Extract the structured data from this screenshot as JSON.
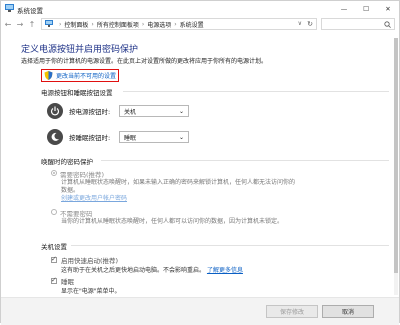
{
  "window": {
    "title": "系统设置",
    "controls": {
      "minimize": "—",
      "maximize": "☐",
      "close": "✕"
    }
  },
  "address_bar": {
    "back": "←",
    "forward": "→",
    "up": "↑",
    "crumbs": [
      "控制面板",
      "所有控制面板项",
      "电源选项",
      "系统设置"
    ],
    "dropdown": "∨",
    "refresh": "↻"
  },
  "main": {
    "heading": "定义电源按钮并启用密码保护",
    "description": "选择适用于你的计算机的电源设置。在此页上对设置所做的更改将应用于你所有的电源计划。",
    "change_link": "更改当前不可用的设置",
    "power_section": {
      "title": "电源按钮和睡眠按钮设置",
      "rows": [
        {
          "label": "按电源按钮时:",
          "value": "关机"
        },
        {
          "label": "按睡眠按钮时:",
          "value": "睡眠"
        }
      ]
    },
    "wake_section": {
      "title": "唤醒时的密码保护",
      "options": [
        {
          "label": "需要密码(推荐)",
          "desc_line1": "计算机从睡眠状态唤醒时，如果未输入正确的密码来解锁计算机，任何人都无法访问你的",
          "desc_line2": "数据。",
          "link": "创建或更改用户帐户密码",
          "checked": true
        },
        {
          "label": "不需要密码",
          "desc_line1": "当你的计算机从睡眠状态唤醒时，任何人都可以访问你的数据，因为计算机未锁定。",
          "checked": false
        }
      ]
    },
    "shutdown_section": {
      "title": "关机设置",
      "options": [
        {
          "label": "启用快速启动(推荐)",
          "desc": "这有助于在关机之后更快地启动电脑。不会影响重启。",
          "link": "了解更多信息",
          "checked": true
        },
        {
          "label": "睡眠",
          "desc": "显示在\"电源\"菜单中。",
          "checked": true
        }
      ]
    }
  },
  "footer": {
    "save": "保存修改",
    "cancel": "取消"
  },
  "colors": {
    "heading": "#1e3287",
    "link": "#0a5fc4",
    "highlight_border": "#e01010"
  }
}
